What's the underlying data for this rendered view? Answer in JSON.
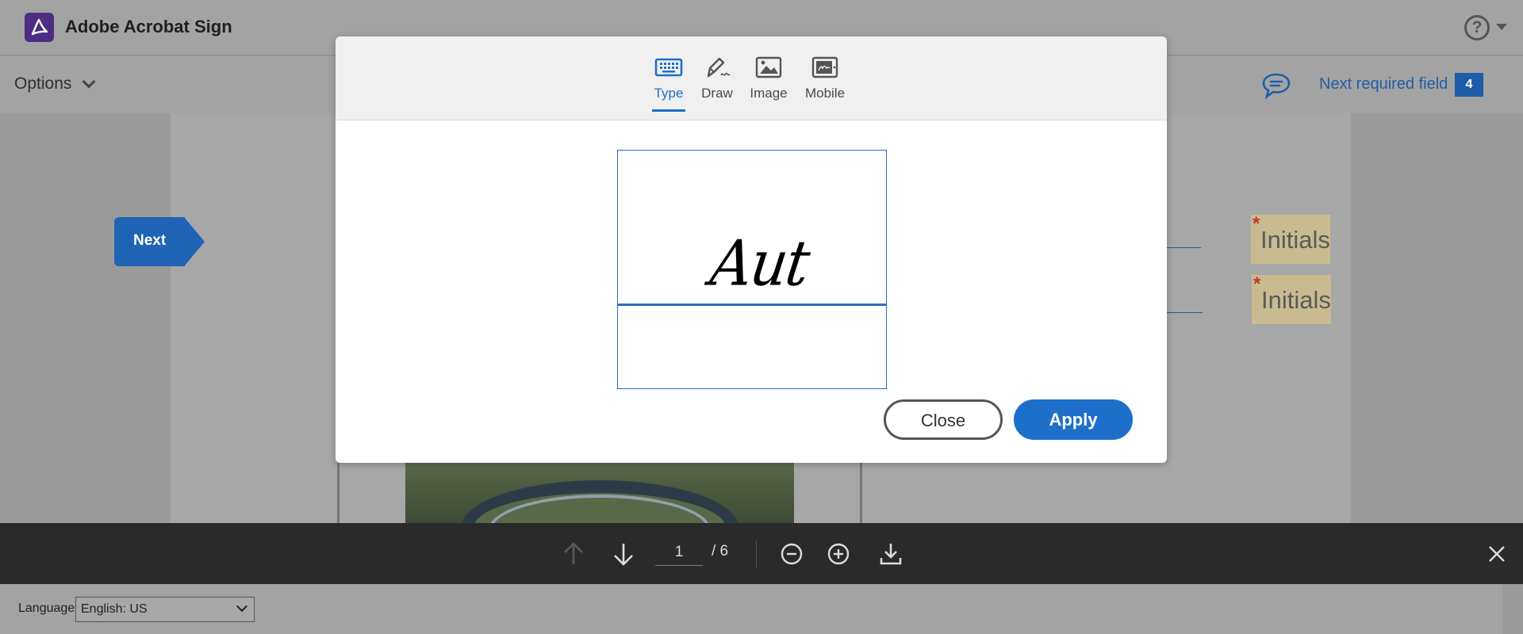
{
  "app": {
    "title": "Adobe Acrobat Sign",
    "help_glyph": "?"
  },
  "subbar": {
    "options_label": "Options",
    "next_required_label": "Next required field",
    "next_required_count": "4"
  },
  "document": {
    "next_flag_label": "Next",
    "initials": [
      {
        "label": "Initials",
        "required_mark": "*"
      },
      {
        "label": "Initials",
        "required_mark": "*"
      }
    ]
  },
  "modal": {
    "tabs": [
      {
        "label": "Type",
        "icon": "keyboard-icon",
        "active": true
      },
      {
        "label": "Draw",
        "icon": "pen-icon",
        "active": false
      },
      {
        "label": "Image",
        "icon": "image-icon",
        "active": false
      },
      {
        "label": "Mobile",
        "icon": "mobile-icon",
        "active": false
      }
    ],
    "signature_text": "Aut",
    "close_label": "Close",
    "apply_label": "Apply"
  },
  "toolbar": {
    "current_page": "1",
    "total_pages": "/ 6"
  },
  "footer": {
    "language_label": "Language",
    "language_value": "English: US"
  },
  "colors": {
    "accent": "#1e6fc9",
    "brand": "#4b2e83",
    "initials_bg": "#c8bb8f",
    "toolbar_bg": "#2a2a2a"
  }
}
